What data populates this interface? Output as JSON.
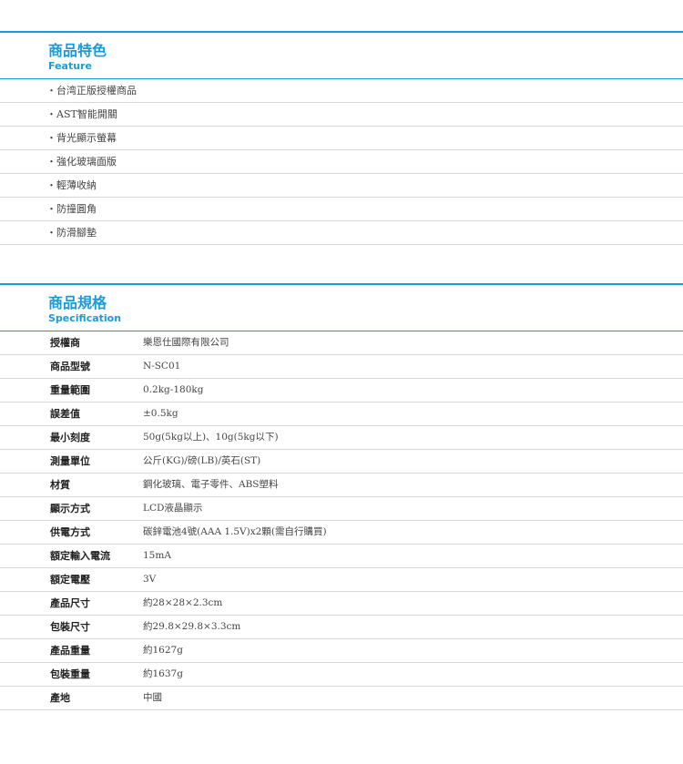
{
  "feature": {
    "title": "商品特色",
    "subtitle": "Feature",
    "items": [
      "・台湾正版授權商品",
      "・AST智能開關",
      "・背光顯示螢幕",
      "・強化玻璃面版",
      "・輕薄收納",
      "・防撞圓角",
      "・防滑腳墊"
    ]
  },
  "spec": {
    "title": "商品規格",
    "subtitle": "Specification",
    "rows": [
      {
        "key": "授權商",
        "value": "樂恩仕國際有限公司"
      },
      {
        "key": "商品型號",
        "value": "N-SC01"
      },
      {
        "key": "重量範圍",
        "value": "0.2kg-180kg"
      },
      {
        "key": "誤差值",
        "value": "±0.5kg"
      },
      {
        "key": "最小刻度",
        "value": "50g(5kg以上)、10g(5kg以下)"
      },
      {
        "key": "測量單位",
        "value": "公斤(KG)/磅(LB)/英石(ST)"
      },
      {
        "key": "材質",
        "value": "鋼化玻璃、電子零件、ABS塑料"
      },
      {
        "key": "顯示方式",
        "value": "LCD液晶顯示"
      },
      {
        "key": "供電方式",
        "value": "碳鋅電池4號(AAA 1.5V)x2顆(需自行購買)"
      },
      {
        "key": "額定輸入電流",
        "value": "15mA"
      },
      {
        "key": "額定電壓",
        "value": "3V"
      },
      {
        "key": "產品尺寸",
        "value": "約28×28×2.3cm"
      },
      {
        "key": "包裝尺寸",
        "value": "約29.8×29.8×3.3cm"
      },
      {
        "key": "產品重量",
        "value": "約1627g"
      },
      {
        "key": "包裝重量",
        "value": "約1637g"
      },
      {
        "key": "產地",
        "value": "中國"
      }
    ]
  },
  "colors": {
    "accent": "#1a9bd7",
    "divider": "#d6d6d6"
  }
}
